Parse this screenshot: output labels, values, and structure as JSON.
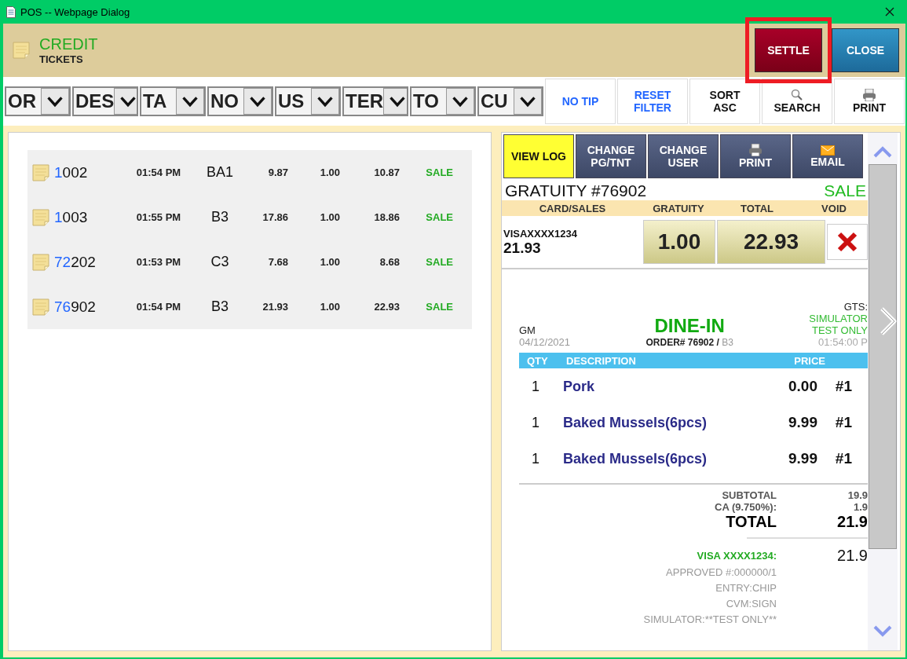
{
  "window": {
    "title": "POS -- Webpage Dialog"
  },
  "header": {
    "title": "CREDIT",
    "subtitle": "TICKETS",
    "buttons": [
      {
        "label": "SETTLE",
        "kind": "settle",
        "highlighted": true
      },
      {
        "label": "CLOSE",
        "kind": "close",
        "highlighted": false
      }
    ]
  },
  "filters": [
    {
      "label": "OR"
    },
    {
      "label": "DES"
    },
    {
      "label": "TA"
    },
    {
      "label": "NO"
    },
    {
      "label": "US"
    },
    {
      "label": "TER"
    },
    {
      "label": "TO"
    },
    {
      "label": "CU"
    }
  ],
  "toolbar": [
    {
      "label": "NO TIP",
      "kind": "link"
    },
    {
      "label": "RESET FILTER",
      "kind": "link"
    },
    {
      "label": "SORT ASC",
      "kind": "plain"
    },
    {
      "label": "SEARCH",
      "kind": "search"
    },
    {
      "label": "PRINT",
      "kind": "print"
    }
  ],
  "tickets": [
    {
      "number_match": "1",
      "number_rest": "002",
      "time": "01:54 PM",
      "table": "BA1",
      "amount": "9.87",
      "gratuity": "1.00",
      "total": "10.87",
      "status": "SALE"
    },
    {
      "number_match": "1",
      "number_rest": "003",
      "time": "01:55 PM",
      "table": "B3",
      "amount": "17.86",
      "gratuity": "1.00",
      "total": "18.86",
      "status": "SALE"
    },
    {
      "number_match": "72",
      "number_rest": "202",
      "time": "01:53 PM",
      "table": "C3",
      "amount": "7.68",
      "gratuity": "1.00",
      "total": "8.68",
      "status": "SALE"
    },
    {
      "number_match": "76",
      "number_rest": "902",
      "time": "01:54 PM",
      "table": "B3",
      "amount": "21.93",
      "gratuity": "1.00",
      "total": "22.93",
      "status": "SALE"
    }
  ],
  "detail": {
    "actions": [
      {
        "label": "VIEW LOG",
        "kind": "text",
        "selected": true
      },
      {
        "label": "CHANGE PG/TNT",
        "kind": "text",
        "selected": false
      },
      {
        "label": "CHANGE USER",
        "kind": "text",
        "selected": false
      },
      {
        "label": "PRINT",
        "kind": "print",
        "selected": false
      },
      {
        "label": "EMAIL",
        "kind": "email",
        "selected": false
      }
    ],
    "title": "GRATUITY #76902",
    "status": "SALE",
    "columns": [
      "CARD/SALES",
      "GRATUITY",
      "TOTAL",
      "VOID"
    ],
    "card": "VISAXXXX1234",
    "sales": "21.93",
    "gratuity": "1.00",
    "total": "22.93",
    "receipt": {
      "server": "GM",
      "date": "04/12/2021",
      "order_type": "DINE-IN",
      "order_label": "ORDER# 76902 /",
      "table": "B3",
      "guests": "GTS:",
      "mode": "SIMULATOR",
      "mode_note": "TEST ONLY",
      "time": "01:54:00 P",
      "columns": [
        "QTY",
        "DESCRIPTION",
        "PRICE"
      ],
      "items": [
        {
          "qty": "1",
          "name": "Pork",
          "price": "0.00",
          "seat": "#1"
        },
        {
          "qty": "1",
          "name": "Baked Mussels(6pcs)",
          "price": "9.99",
          "seat": "#1"
        },
        {
          "qty": "1",
          "name": "Baked Mussels(6pcs)",
          "price": "9.99",
          "seat": "#1"
        }
      ],
      "totals": [
        {
          "label": "SUBTOTAL",
          "value": "19.9",
          "kind": "minor"
        },
        {
          "label": "CA (9.750%):",
          "value": "1.9",
          "kind": "minor"
        },
        {
          "label": "TOTAL",
          "value": "21.9",
          "kind": "major"
        }
      ],
      "payment": {
        "label": "VISA XXXX1234:",
        "amount": "21.9"
      },
      "payment_lines": [
        "APPROVED #:000000/1",
        "ENTRY:CHIP",
        "CVM:SIGN",
        "SIMULATOR:**TEST ONLY**"
      ]
    }
  }
}
